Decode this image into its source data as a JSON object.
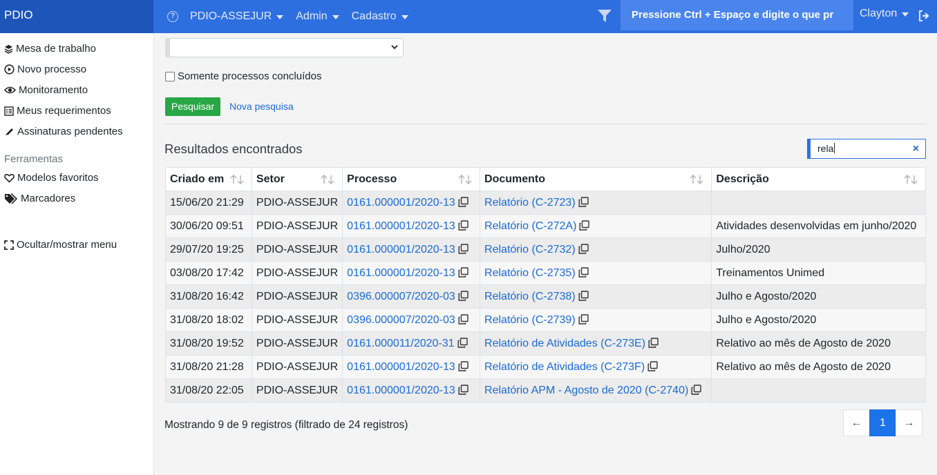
{
  "topbar": {
    "brand": "PDIO",
    "menus": [
      "PDIO-ASSEJUR",
      "Admin",
      "Cadastro"
    ],
    "command_hint": "Pressione Ctrl + Espaço e digite o que pr",
    "user": "Clayton",
    "colors": {
      "bar": "#2e6fe0",
      "brand": "#1e55b9"
    }
  },
  "sidebar": {
    "items": [
      {
        "label": "Mesa de trabalho",
        "icon": "layers-icon"
      },
      {
        "label": "Novo processo",
        "icon": "play-circle-icon"
      },
      {
        "label": "Monitoramento",
        "icon": "eye-icon"
      },
      {
        "label": "Meus requerimentos",
        "icon": "list-icon"
      },
      {
        "label": "Assinaturas pendentes",
        "icon": "pen-icon"
      }
    ],
    "tools_header": "Ferramentas",
    "tools": [
      {
        "label": "Modelos favoritos",
        "icon": "heart-icon"
      },
      {
        "label": "Marcadores",
        "icon": "tags-icon"
      }
    ],
    "toggle": {
      "label": "Ocultar/mostrar menu",
      "icon": "fullscreen-icon"
    }
  },
  "form": {
    "select_value": "",
    "checkbox_label": "Somente processos concluídos",
    "checkbox_checked": false,
    "search_button": "Pesquisar",
    "new_search_link": "Nova pesquisa"
  },
  "results": {
    "title": "Resultados encontrados",
    "filter_value": "rela",
    "filter_clear": "×",
    "columns": [
      "Criado em",
      "Setor",
      "Processo",
      "Documento",
      "Descrição"
    ],
    "rows": [
      {
        "created": "15/06/20 21:29",
        "sector": "PDIO-ASSEJUR",
        "process": "0161.000001/2020-13",
        "document": "Relatório (C-2723)",
        "description": ""
      },
      {
        "created": "30/06/20 09:51",
        "sector": "PDIO-ASSEJUR",
        "process": "0161.000001/2020-13",
        "document": "Relatório (C-272A)",
        "description": "Atividades desenvolvidas em junho/2020"
      },
      {
        "created": "29/07/20 19:25",
        "sector": "PDIO-ASSEJUR",
        "process": "0161.000001/2020-13",
        "document": "Relatório (C-2732)",
        "description": "Julho/2020"
      },
      {
        "created": "03/08/20 17:42",
        "sector": "PDIO-ASSEJUR",
        "process": "0161.000001/2020-13",
        "document": "Relatório (C-2735)",
        "description": "Treinamentos Unimed"
      },
      {
        "created": "31/08/20 16:42",
        "sector": "PDIO-ASSEJUR",
        "process": "0396.000007/2020-03",
        "document": "Relatório (C-2738)",
        "description": "Julho e Agosto/2020"
      },
      {
        "created": "31/08/20 18:02",
        "sector": "PDIO-ASSEJUR",
        "process": "0396.000007/2020-03",
        "document": "Relatório (C-2739)",
        "description": "Julho e Agosto/2020"
      },
      {
        "created": "31/08/20 19:52",
        "sector": "PDIO-ASSEJUR",
        "process": "0161.000011/2020-31",
        "document": "Relatório de Atividades (C-273E)",
        "description": "Relativo ao mês de Agosto de 2020"
      },
      {
        "created": "31/08/20 21:28",
        "sector": "PDIO-ASSEJUR",
        "process": "0161.000001/2020-13",
        "document": "Relatório de Atividades (C-273F)",
        "description": "Relativo ao mês de Agosto de 2020"
      },
      {
        "created": "31/08/20 22:05",
        "sector": "PDIO-ASSEJUR",
        "process": "0161.000001/2020-13",
        "document": "Relatório APM - Agosto de 2020 (C-2740)",
        "description": ""
      }
    ],
    "summary": "Mostrando 9 de 9 registros (filtrado de 24 registros)",
    "pagination": {
      "prev": "←",
      "current": "1",
      "next": "→"
    }
  }
}
